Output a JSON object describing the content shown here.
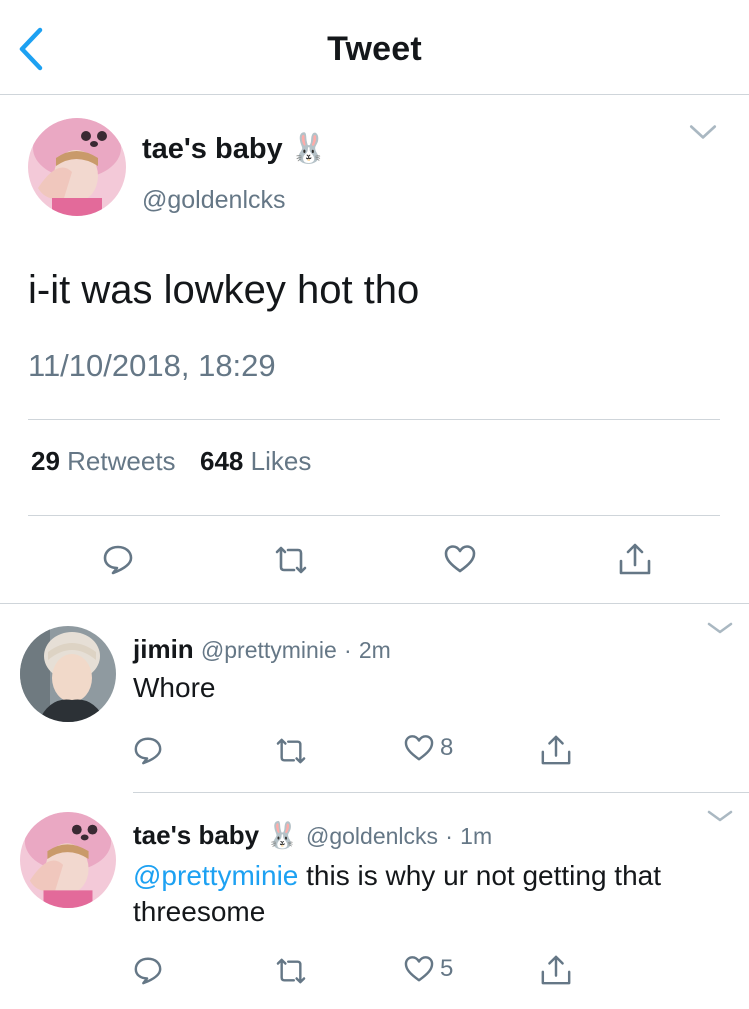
{
  "header": {
    "title": "Tweet"
  },
  "main_tweet": {
    "display_name": "tae's baby",
    "emoji": "🐰",
    "handle": "@goldenlcks",
    "text": "i-it was lowkey hot tho",
    "timestamp": "11/10/2018, 18:29",
    "retweets_count": "29",
    "retweets_label": "Retweets",
    "likes_count": "648",
    "likes_label": "Likes"
  },
  "replies": [
    {
      "display_name": "jimin",
      "handle": "@prettyminie",
      "separator": "·",
      "time": "2m",
      "text": "Whore",
      "likes": "8"
    },
    {
      "display_name": "tae's baby",
      "emoji": "🐰",
      "handle": "@goldenlcks",
      "separator": "·",
      "time": "1m",
      "mention": "@prettyminie",
      "text": "this is why ur not getting that threesome",
      "likes": "5"
    }
  ],
  "colors": {
    "accent": "#1da1f2",
    "muted": "#657786",
    "icon": "#657786",
    "divider": "#cfd5da"
  },
  "icons": [
    "back-chevron-icon",
    "chevron-down-icon",
    "reply-icon",
    "retweet-icon",
    "like-icon",
    "share-icon",
    "avatar"
  ]
}
